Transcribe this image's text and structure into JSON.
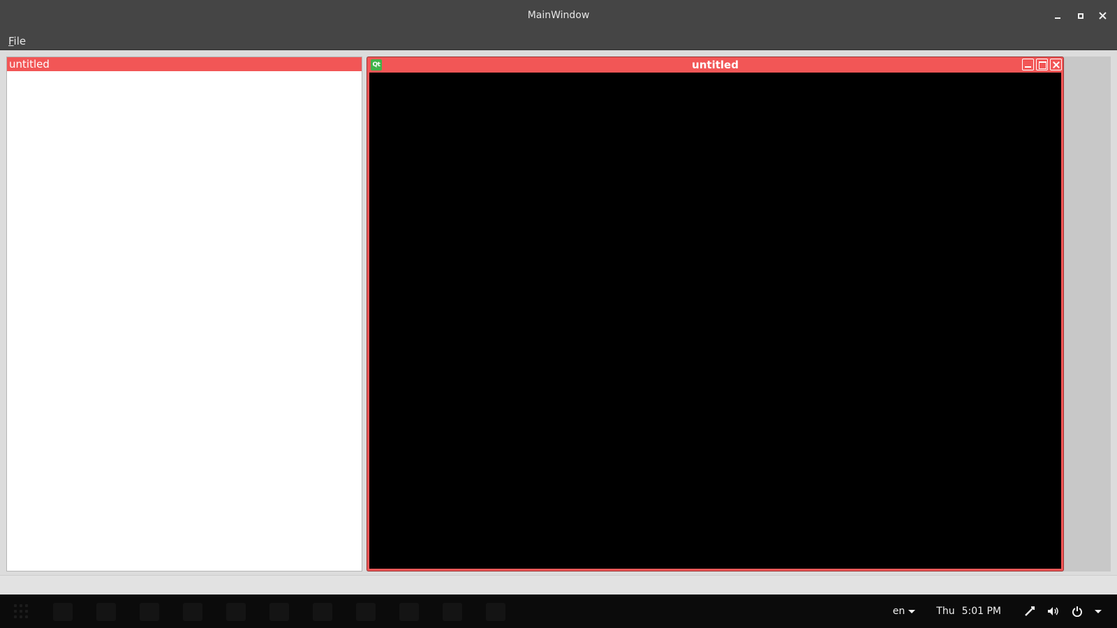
{
  "window": {
    "title": "MainWindow",
    "controls": {
      "minimize": "minimize-icon",
      "maximize": "maximize-icon",
      "close": "close-icon"
    }
  },
  "menubar": {
    "items": [
      {
        "mnemonic": "F",
        "rest": "ile"
      }
    ]
  },
  "left_panel": {
    "header": "untitled"
  },
  "subwindow": {
    "title": "untitled",
    "logo_text": "Qt",
    "accent": "#f25656"
  },
  "taskbar": {
    "language": "en",
    "day": "Thu",
    "time": "5:01 PM",
    "tray_icons": [
      "network-icon",
      "volume-icon",
      "power-icon"
    ]
  }
}
